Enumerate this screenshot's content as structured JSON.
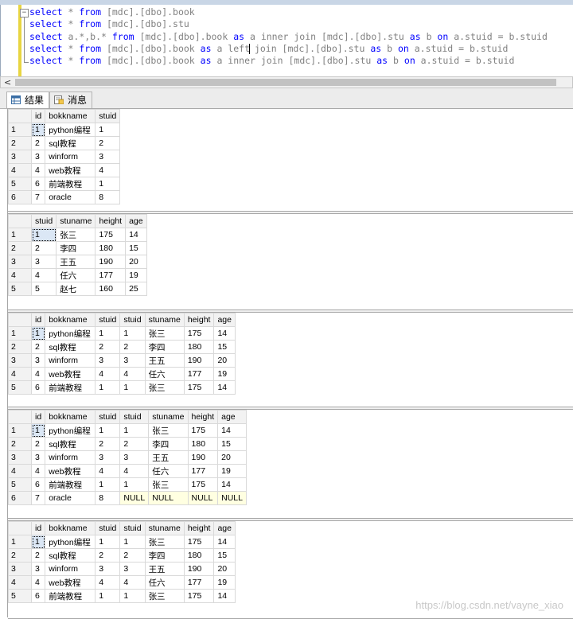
{
  "editor": {
    "lines": [
      [
        {
          "t": "select",
          "c": "kw"
        },
        {
          "t": " * ",
          "c": "gr"
        },
        {
          "t": "from",
          "c": "kw"
        },
        {
          "t": " [mdc].[dbo].book",
          "c": "gr"
        }
      ],
      [
        {
          "t": "select",
          "c": "kw"
        },
        {
          "t": " * ",
          "c": "gr"
        },
        {
          "t": "from",
          "c": "kw"
        },
        {
          "t": " [mdc].[dbo].stu",
          "c": "gr"
        }
      ],
      [
        {
          "t": "select",
          "c": "kw"
        },
        {
          "t": " a.*,b.* ",
          "c": "gr"
        },
        {
          "t": "from",
          "c": "kw"
        },
        {
          "t": " [mdc].[dbo].book ",
          "c": "gr"
        },
        {
          "t": "as",
          "c": "kw"
        },
        {
          "t": " a ",
          "c": "gr"
        },
        {
          "t": "inner join",
          "c": "gr"
        },
        {
          "t": " [mdc].[dbo].stu ",
          "c": "gr"
        },
        {
          "t": "as",
          "c": "kw"
        },
        {
          "t": " b ",
          "c": "gr"
        },
        {
          "t": "on",
          "c": "kw"
        },
        {
          "t": " a.stuid = b.stuid",
          "c": "gr"
        }
      ],
      [
        {
          "t": "select",
          "c": "kw"
        },
        {
          "t": " * ",
          "c": "gr"
        },
        {
          "t": "from",
          "c": "kw"
        },
        {
          "t": " [mdc].[dbo].book ",
          "c": "gr"
        },
        {
          "t": "as",
          "c": "kw"
        },
        {
          "t": " a ",
          "c": "gr"
        },
        {
          "t": "left",
          "c": "gr"
        },
        {
          "t": "|",
          "c": "cursor"
        },
        {
          "t": " join",
          "c": "gr"
        },
        {
          "t": " [mdc].[dbo].stu ",
          "c": "gr"
        },
        {
          "t": "as",
          "c": "kw"
        },
        {
          "t": " b ",
          "c": "gr"
        },
        {
          "t": "on",
          "c": "kw"
        },
        {
          "t": " a.stuid = b.stuid",
          "c": "gr"
        }
      ],
      [
        {
          "t": "select",
          "c": "kw"
        },
        {
          "t": " * ",
          "c": "gr"
        },
        {
          "t": "from",
          "c": "kw"
        },
        {
          "t": " [mdc].[dbo].book ",
          "c": "gr"
        },
        {
          "t": "as",
          "c": "kw"
        },
        {
          "t": " a ",
          "c": "gr"
        },
        {
          "t": "inner join",
          "c": "gr"
        },
        {
          "t": " [mdc].[dbo].stu ",
          "c": "gr"
        },
        {
          "t": "as",
          "c": "kw"
        },
        {
          "t": " b ",
          "c": "gr"
        },
        {
          "t": "on",
          "c": "kw"
        },
        {
          "t": " a.stuid = b.stuid",
          "c": "gr"
        }
      ]
    ],
    "fold_symbol": "−",
    "scroll_left_arrow": "<"
  },
  "tabs": [
    {
      "label": "结果",
      "icon": "grid-icon",
      "active": true
    },
    {
      "label": "消息",
      "icon": "message-icon",
      "active": false
    }
  ],
  "result_sets": [
    {
      "columns": [
        "id",
        "bokkname",
        "stuid"
      ],
      "rows": [
        [
          "1",
          "1",
          "python编程",
          "1"
        ],
        [
          "2",
          "2",
          "sql教程",
          "2"
        ],
        [
          "3",
          "3",
          "winform",
          "3"
        ],
        [
          "4",
          "4",
          "web教程",
          "4"
        ],
        [
          "5",
          "6",
          "前端教程",
          "1"
        ],
        [
          "6",
          "7",
          "oracle",
          "8"
        ]
      ]
    },
    {
      "columns": [
        "stuid",
        "stuname",
        "height",
        "age"
      ],
      "rows": [
        [
          "1",
          "1",
          "张三",
          "175",
          "14"
        ],
        [
          "2",
          "2",
          "李四",
          "180",
          "15"
        ],
        [
          "3",
          "3",
          "王五",
          "190",
          "20"
        ],
        [
          "4",
          "4",
          "任六",
          "177",
          "19"
        ],
        [
          "5",
          "5",
          "赵七",
          "160",
          "25"
        ]
      ]
    },
    {
      "columns": [
        "id",
        "bokkname",
        "stuid",
        "stuid",
        "stuname",
        "height",
        "age"
      ],
      "rows": [
        [
          "1",
          "1",
          "python编程",
          "1",
          "1",
          "张三",
          "175",
          "14"
        ],
        [
          "2",
          "2",
          "sql教程",
          "2",
          "2",
          "李四",
          "180",
          "15"
        ],
        [
          "3",
          "3",
          "winform",
          "3",
          "3",
          "王五",
          "190",
          "20"
        ],
        [
          "4",
          "4",
          "web教程",
          "4",
          "4",
          "任六",
          "177",
          "19"
        ],
        [
          "5",
          "6",
          "前端教程",
          "1",
          "1",
          "张三",
          "175",
          "14"
        ]
      ]
    },
    {
      "columns": [
        "id",
        "bokkname",
        "stuid",
        "stuid",
        "stuname",
        "height",
        "age"
      ],
      "rows": [
        [
          "1",
          "1",
          "python编程",
          "1",
          "1",
          "张三",
          "175",
          "14"
        ],
        [
          "2",
          "2",
          "sql教程",
          "2",
          "2",
          "李四",
          "180",
          "15"
        ],
        [
          "3",
          "3",
          "winform",
          "3",
          "3",
          "王五",
          "190",
          "20"
        ],
        [
          "4",
          "4",
          "web教程",
          "4",
          "4",
          "任六",
          "177",
          "19"
        ],
        [
          "5",
          "6",
          "前端教程",
          "1",
          "1",
          "张三",
          "175",
          "14"
        ],
        [
          "6",
          "7",
          "oracle",
          "8",
          "NULL",
          "NULL",
          "NULL",
          "NULL"
        ]
      ]
    },
    {
      "columns": [
        "id",
        "bokkname",
        "stuid",
        "stuid",
        "stuname",
        "height",
        "age"
      ],
      "rows": [
        [
          "1",
          "1",
          "python编程",
          "1",
          "1",
          "张三",
          "175",
          "14"
        ],
        [
          "2",
          "2",
          "sql教程",
          "2",
          "2",
          "李四",
          "180",
          "15"
        ],
        [
          "3",
          "3",
          "winform",
          "3",
          "3",
          "王五",
          "190",
          "20"
        ],
        [
          "4",
          "4",
          "web教程",
          "4",
          "4",
          "任六",
          "177",
          "19"
        ],
        [
          "5",
          "6",
          "前端教程",
          "1",
          "1",
          "张三",
          "175",
          "14"
        ]
      ]
    }
  ],
  "watermark": "https://blog.csdn.net/vayne_xiao",
  "colors": {
    "keyword": "#0000ff",
    "null_cell": "#ffffe1",
    "change_bar": "#e8d542"
  }
}
